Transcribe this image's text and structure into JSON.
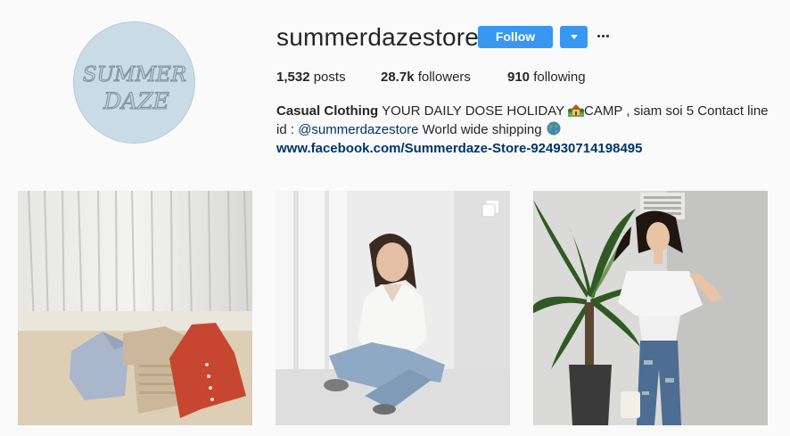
{
  "profile": {
    "username": "summerdazestore",
    "avatar_text_line1": "SUMMER",
    "avatar_text_line2": "DAZE",
    "avatar_icon": "brand-logo",
    "follow_label": "Follow",
    "dropdown_icon": "chevron-down-icon",
    "more_icon": "more-options-icon"
  },
  "stats": {
    "posts_count": "1,532",
    "posts_label": " posts",
    "followers_count": "28.7k",
    "followers_label": " followers",
    "following_count": "910",
    "following_label": " following"
  },
  "bio": {
    "name": "Casual Clothing",
    "text_part1": " YOUR DAILY DOSE HOLIDAY ",
    "emoji1": "house-with-garden-emoji",
    "text_part2": "CAMP , siam soi 5 Contact line id : ",
    "mention": "@summerdazestore",
    "text_part3": " World wide shipping ",
    "emoji2": "globe-emoji",
    "link": "www.facebook.com/Summerdaze-Store-924930714198495"
  },
  "posts": [
    {
      "subject": "clothes flat-lay under white curtain",
      "multi": false
    },
    {
      "subject": "woman in white shirt sitting on floor",
      "multi": true,
      "badge_icon": "carousel-icon"
    },
    {
      "subject": "woman in off-shoulder top beside palm plant",
      "multi": false
    }
  ],
  "colors": {
    "accent": "#3897f0",
    "link": "#003569",
    "text": "#262626",
    "background": "#fafafa"
  }
}
